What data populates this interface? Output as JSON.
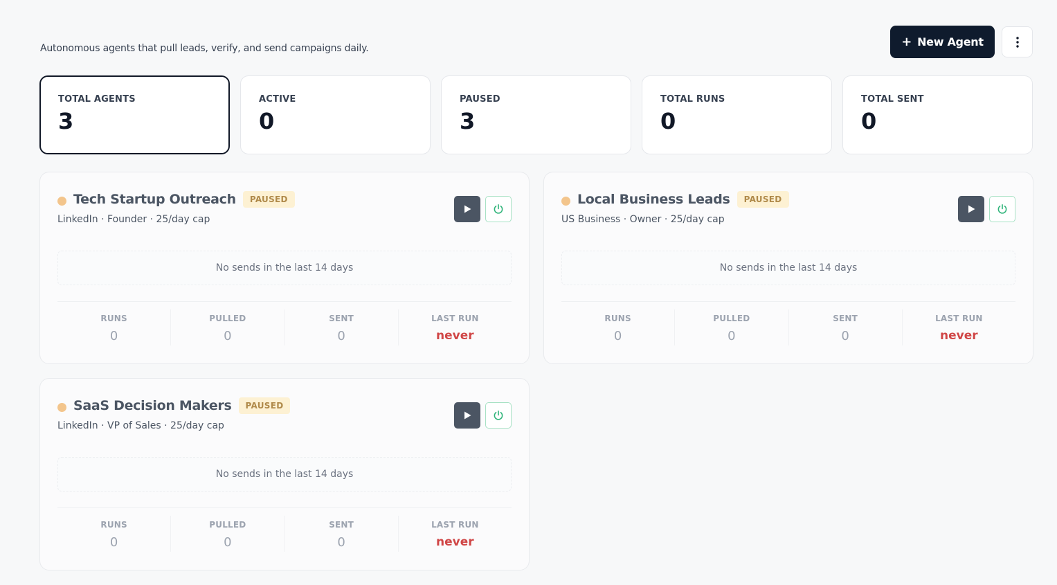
{
  "header": {
    "subtitle": "Autonomous agents that pull leads, verify, and send campaigns daily.",
    "new_agent_label": "New Agent",
    "new_agent_icon": "plus-icon",
    "more_icon": "more-vertical-icon"
  },
  "stats": [
    {
      "label": "TOTAL AGENTS",
      "value": "3"
    },
    {
      "label": "ACTIVE",
      "value": "0"
    },
    {
      "label": "PAUSED",
      "value": "3"
    },
    {
      "label": "TOTAL RUNS",
      "value": "0"
    },
    {
      "label": "TOTAL SENT",
      "value": "0"
    }
  ],
  "agents": [
    {
      "name": "Tech Startup Outreach",
      "status": "PAUSED",
      "meta": "LinkedIn · Founder · 25/day cap",
      "empty_text": "No sends in the last 14 days",
      "metrics": [
        {
          "label": "RUNS",
          "value": "0"
        },
        {
          "label": "PULLED",
          "value": "0"
        },
        {
          "label": "SENT",
          "value": "0"
        },
        {
          "label": "LAST RUN",
          "value": "never"
        }
      ]
    },
    {
      "name": "Local Business Leads",
      "status": "PAUSED",
      "meta": "US Business · Owner · 25/day cap",
      "empty_text": "No sends in the last 14 days",
      "metrics": [
        {
          "label": "RUNS",
          "value": "0"
        },
        {
          "label": "PULLED",
          "value": "0"
        },
        {
          "label": "SENT",
          "value": "0"
        },
        {
          "label": "LAST RUN",
          "value": "never"
        }
      ]
    },
    {
      "name": "SaaS Decision Makers",
      "status": "PAUSED",
      "meta": "LinkedIn · VP of Sales · 25/day cap",
      "empty_text": "No sends in the last 14 days",
      "metrics": [
        {
          "label": "RUNS",
          "value": "0"
        },
        {
          "label": "PULLED",
          "value": "0"
        },
        {
          "label": "SENT",
          "value": "0"
        },
        {
          "label": "LAST RUN",
          "value": "never"
        }
      ]
    }
  ],
  "colors": {
    "primary_button": "#0f1b2d",
    "paused_dot": "#f3c58c",
    "paused_badge_bg": "#fdf1d3",
    "paused_badge_text": "#b08a4a",
    "never_text": "#d04646",
    "power_border": "#a7e1c4"
  }
}
